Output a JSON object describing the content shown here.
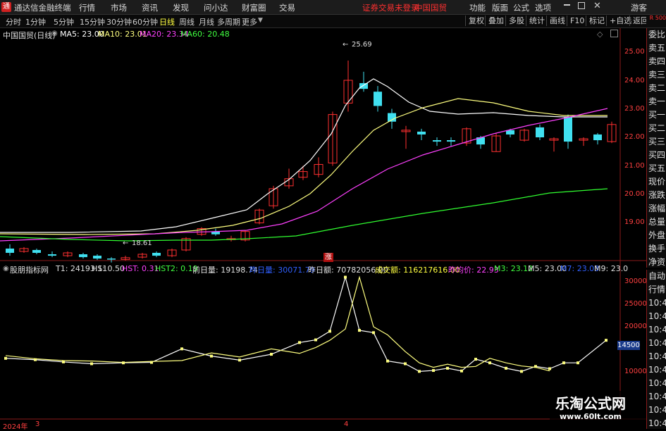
{
  "menubar": {
    "app_title": "通达信金融终端",
    "menus": [
      "行情",
      "市场",
      "资讯",
      "发现",
      "问小达",
      "财富圈",
      "交易"
    ],
    "notice": "证券交易未登录",
    "stock": "中国国贸",
    "right_menus": [
      "功能",
      "版面",
      "公式",
      "选项"
    ],
    "user": "游客"
  },
  "toolbar": {
    "periods": [
      "分时",
      "1分钟",
      "5分钟",
      "15分钟",
      "30分钟",
      "60分钟",
      "日线",
      "周线",
      "月线",
      "多周期",
      "更多"
    ],
    "active_period": "日线",
    "right_buttons": [
      "复权",
      "叠加",
      "多股",
      "统计",
      "画线",
      "F10",
      "标记",
      "+自选",
      "返回"
    ]
  },
  "main_chart": {
    "title": "中国国贸(日线)",
    "ma": [
      {
        "label": "MA5: 23.00",
        "color": "#ffffff"
      },
      {
        "label": "MA10: 23.01",
        "color": "#ffff80"
      },
      {
        "label": "MA20: 23.34",
        "color": "#ff40ff"
      },
      {
        "label": "MA60: 20.48",
        "color": "#40ff40"
      }
    ],
    "price_axis": [
      "25.00",
      "24.00",
      "23.00",
      "22.00",
      "21.00",
      "20.00",
      "19.00"
    ],
    "high_label": "25.69",
    "low_label": "18.61",
    "zhang_badge": "涨"
  },
  "indicator": {
    "name": "股朋指标网",
    "values": [
      {
        "label": "T1: 24193.11",
        "color": "#e0e0e0"
      },
      {
        "label": "HS: 0.50",
        "color": "#e0e0e0"
      },
      {
        "label": "HST: 0.31",
        "color": "#ff40ff"
      },
      {
        "label": "HST2: 0.19",
        "color": "#40ff40"
      },
      {
        "label": "前日量: 19198.74",
        "color": "#e0e0e0"
      },
      {
        "label": "昨日量: 30071.79",
        "color": "#3060ff"
      },
      {
        "label": "昨日额: 70782056.00",
        "color": "#e0e0e0"
      },
      {
        "label": "成交额: 116217616.00",
        "color": "#ffff40"
      },
      {
        "label": "昨均价: 22.93",
        "color": "#ff40ff"
      },
      {
        "label": "M3: 23.12",
        "color": "#40ff40"
      },
      {
        "label": "M5: 23.00",
        "color": "#e0e0e0"
      },
      {
        "label": "M7: 23.03",
        "color": "#3060ff"
      },
      {
        "label": "M9: 23.0",
        "color": "#e0e0e0"
      }
    ],
    "axis": [
      "30000",
      "25000",
      "20000",
      "15000",
      "10000"
    ],
    "current_value_box": "14500"
  },
  "time_axis": {
    "labels": [
      "2024年",
      "3",
      "4"
    ]
  },
  "sidebar_top": [
    "委比",
    "卖五",
    "卖四",
    "卖三",
    "卖二",
    "卖一",
    "买一",
    "买二",
    "买三",
    "买四",
    "买五",
    "现价",
    "涨跌",
    "涨幅",
    "总量",
    "外盘",
    "换手",
    "净资",
    "收益"
  ],
  "sidebar_top_header": "R 500",
  "sidebar_bottom": [
    "自动",
    "行情",
    "10:44",
    "10:45",
    "10:45",
    "10:45",
    "10:45",
    "10:45",
    "10:45",
    "10:45",
    "10:45",
    "10:45"
  ],
  "watermark": {
    "title": "乐淘公式网",
    "url": "www.60lt.com"
  }
}
